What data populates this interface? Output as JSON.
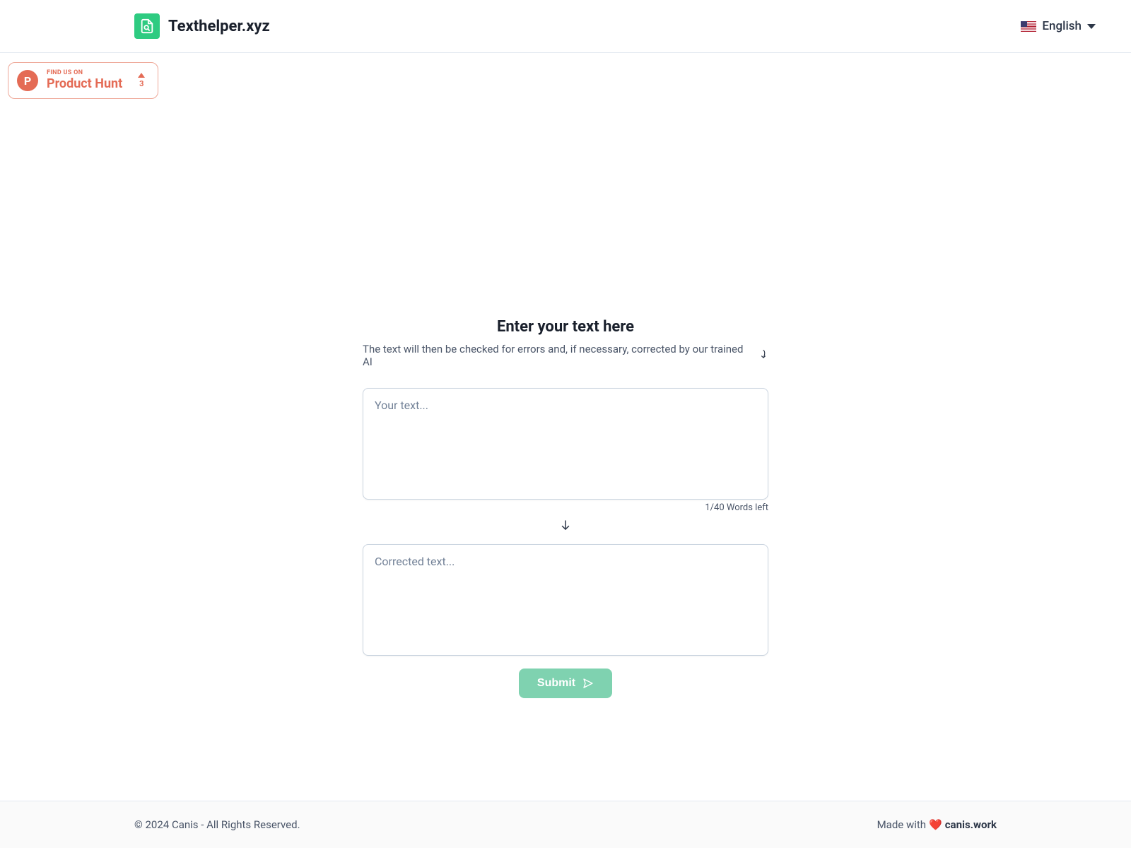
{
  "header": {
    "brand_name": "Texthelper.xyz",
    "language_label": "English"
  },
  "product_hunt": {
    "find_label": "FIND US ON",
    "name": "Product Hunt",
    "letter": "P",
    "upvotes": "3"
  },
  "main": {
    "title": "Enter your text here",
    "subtitle": "The text will then be checked for errors and, if necessary, corrected by our trained AI",
    "input_placeholder": "Your text...",
    "words_left": "1/40 Words left",
    "output_placeholder": "Corrected text...",
    "submit_label": "Submit"
  },
  "footer": {
    "copyright": "© 2024 Canis - All Rights Reserved.",
    "made_with": "Made with",
    "heart": "❤️",
    "link_text": "canis.work"
  }
}
